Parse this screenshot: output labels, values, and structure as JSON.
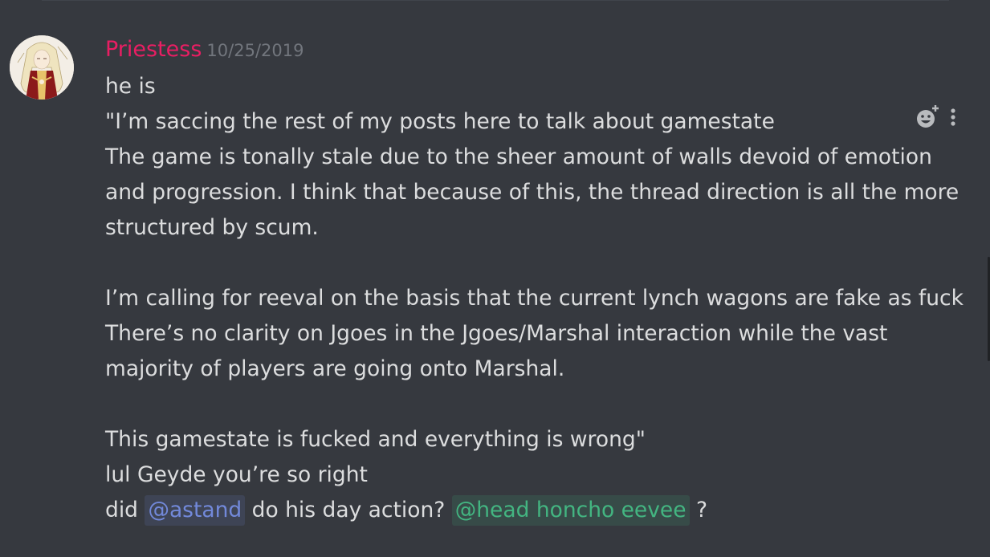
{
  "message": {
    "author": "Priestess",
    "author_color": "#e91e63",
    "timestamp": "10/25/2019",
    "lines": [
      "he is",
      "\"I’m saccing the rest of my posts here to talk about gamestate",
      "The game is tonally stale due to the sheer amount of walls devoid of emotion",
      "and progression. I think that because of this, the thread direction is all the more",
      "structured by scum.",
      "",
      "I’m calling for reeval on the basis that the current lynch wagons are fake as fuck",
      "There’s no clarity on Jgoes in the Jgoes/Marshal interaction while the vast",
      "majority of players are going onto Marshal.",
      "",
      "This gamestate is fucked and everything is wrong\"",
      "lul Geyde you’re so right"
    ],
    "last_line": {
      "part1": "did ",
      "mention_user": "@astand",
      "part2": " do his day action? ",
      "mention_role": "@head honcho eevee",
      "part3": " ?"
    }
  },
  "hover_actions": {
    "add_reaction_icon": "add-reaction-icon",
    "more_icon": "more-vertical-icon"
  },
  "colors": {
    "background": "#36393f",
    "text": "#dcddde",
    "timestamp": "#72767d",
    "user_mention": "#7289da",
    "role_mention": "#43b581"
  }
}
